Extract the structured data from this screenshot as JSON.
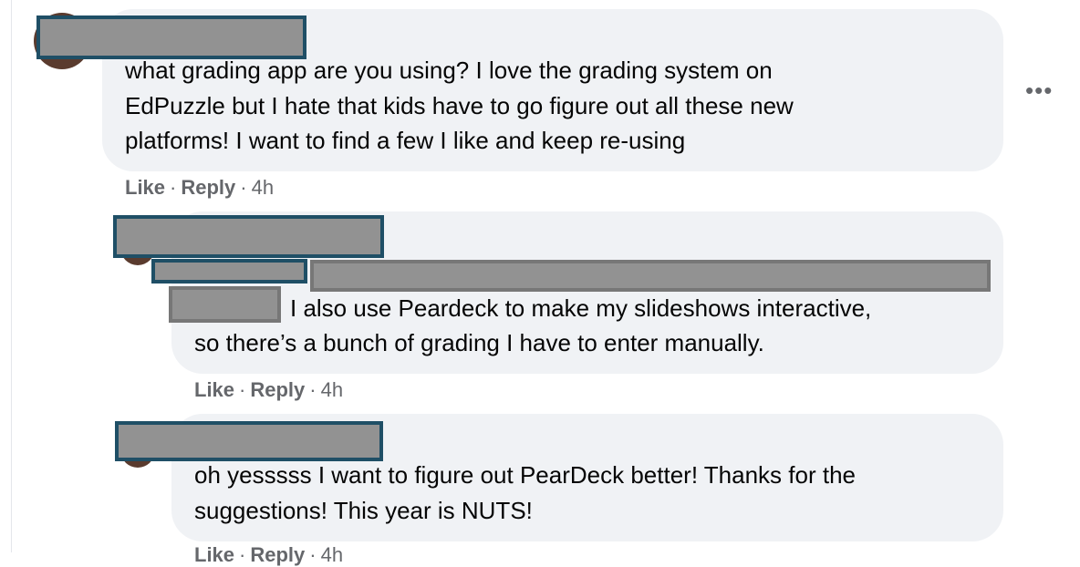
{
  "comments": [
    {
      "text": "what grading app are you using? I love the grading system on EdPuzzle but I hate that kids have to go figure out all these new platforms! I want to find a few I like and keep re-using",
      "lines": [
        "what grading app are you using? I love the grading system on",
        "EdPuzzle but I hate that kids have to go figure out all these new",
        "platforms! I want to find a few I like and keep re-using"
      ],
      "actions": {
        "like": "Like",
        "reply": "Reply",
        "time": "4h",
        "sep": "·"
      }
    },
    {
      "lines": [
        "I also use Peardeck to make my slideshows interactive,",
        "so there’s a bunch of grading I have to enter manually."
      ],
      "actions": {
        "like": "Like",
        "reply": "Reply",
        "time": "4h",
        "sep": "·"
      }
    },
    {
      "lines": [
        "oh yesssss I want to figure out PearDeck better! Thanks for the",
        "suggestions! This year is NUTS!"
      ],
      "actions": {
        "like": "Like",
        "reply": "Reply",
        "time": "4h",
        "sep": "·"
      }
    }
  ],
  "more_menu": {
    "icon": "ellipsis-icon",
    "glyph": "•••"
  },
  "colors": {
    "bubble": "#f0f2f5",
    "redaction_fill": "#929292",
    "redaction_border": "#1f4f66",
    "meta_text": "#65676b"
  }
}
